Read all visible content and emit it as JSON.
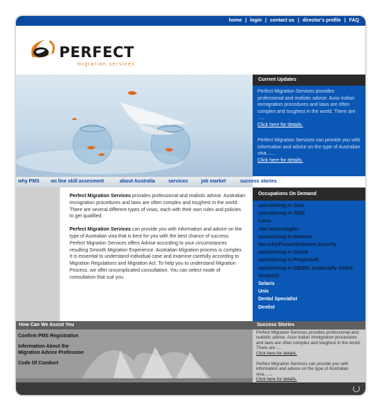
{
  "topnav": {
    "items": [
      "home",
      "login",
      "contact us",
      "director's profile",
      "FAQ"
    ],
    "separator": "|"
  },
  "logo": {
    "word": "PERFECT",
    "subtitle": "migration services"
  },
  "mainnav": {
    "items": [
      "why PMS",
      "on line skill assesment",
      "about Australia",
      "services",
      "job market",
      "success stories"
    ]
  },
  "updates": {
    "title": "Current Updates",
    "blocks": [
      {
        "text": "Perfect Migration Services provides professional and realistic advise. Ausv tralian immigration procedures and laws are often complex and toughest in the world. There are .....",
        "link": "Click here for details."
      },
      {
        "text": "Perfect Migration Services can provide you with information and advice on the type of Australian visa.......",
        "link": "Click here for details."
      }
    ]
  },
  "content": {
    "para1_strong": "Perfect Migration Services",
    "para1_rest": " provides professional and realistic advise. Australian immigration procedures and laws are often complex and toughest in the world. There are several different types of visas, each with their own rules and policies to get qualified.",
    "para2_strong": "Perfect Migration Services",
    "para2_rest": " can provide you with information and advice on the type of Australian visa that is best for you with the best chance of success. Perfect Migration Services offers Advise according to your circumstances resulting Smooth Migration Experience. Australian Migration process is complex. It is essential to understand individual case and examine carefully according to Migration Regulations and Migration Act. To help you to understand Migration Process, we offer uncomplicated consultation. You can select mode of consultation that suit you."
  },
  "occupations": {
    "title": "Occupations On Demand",
    "items": [
      {
        "label": "specialising in Java",
        "white": false
      },
      {
        "label": "specialising in J2EE",
        "white": false
      },
      {
        "label": "Linux",
        "white": false
      },
      {
        "label": ".Net technologies",
        "white": false
      },
      {
        "label": "specialising in Network",
        "white": false
      },
      {
        "label": "Security/Firewall/Internet Security",
        "white": false
      },
      {
        "label": "specialising in Oracle",
        "white": false
      },
      {
        "label": "specialising in PeopleSoft",
        "white": false
      },
      {
        "label": "specialising in SIEBEL (especially Siebel Analytic)",
        "white": false
      },
      {
        "label": "Solaris",
        "white": true
      },
      {
        "label": "Unix",
        "white": true
      },
      {
        "label": "Dental Specialist",
        "white": true
      },
      {
        "label": "Dentist",
        "white": true
      }
    ]
  },
  "assist": {
    "title": "How Can We Assist You",
    "items": [
      "Confirm PMS Registration",
      "Information About the Migration Advice Profession",
      "Code Of Conduct"
    ]
  },
  "stories": {
    "title": "Success Stories",
    "blocks": [
      {
        "text": "Perfect Migration Services provides professional and realistic advise. Ausv tralian immigration procedures and laws are often complex and toughest in the world. There are .....",
        "link": "Click here for details."
      },
      {
        "text": "Perfect Migration Services can provide you with information and advice on the type of Australian visa.......",
        "link": "Click here for details."
      }
    ]
  },
  "colors": {
    "primary_blue": "#0a57b5",
    "nav_blue": "#0b4aa0",
    "accent_orange": "#e07d1a",
    "dark_header": "#2a2a2a"
  }
}
